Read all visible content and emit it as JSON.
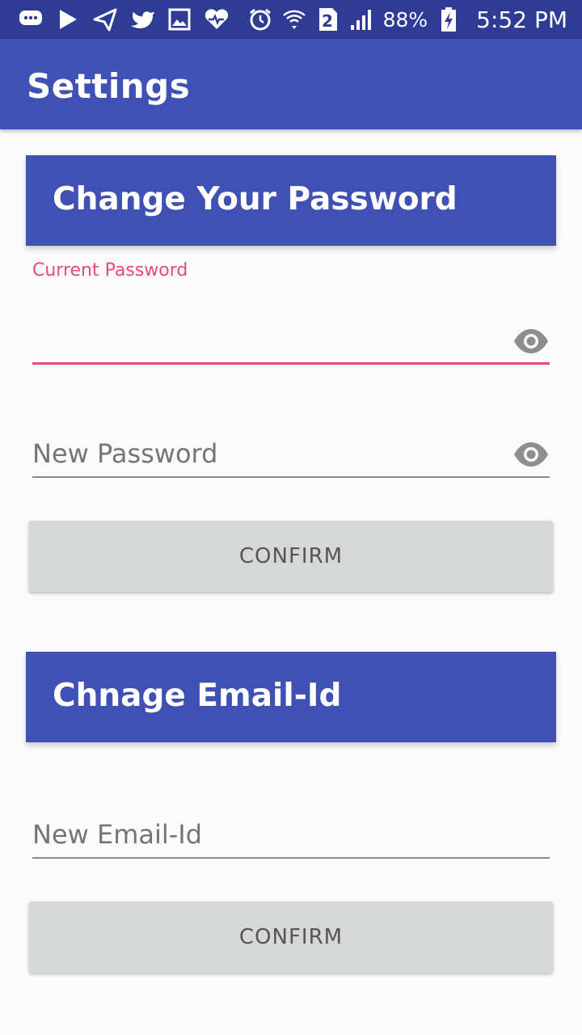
{
  "status_bar": {
    "icons": [
      "chat-bubble-icon",
      "play-store-icon",
      "send-icon",
      "twitter-icon",
      "gallery-icon",
      "heart-icon",
      "alarm-icon",
      "wifi-icon",
      "sim-2-icon",
      "signal-icon",
      "battery-charging-icon"
    ],
    "sim_label": "2",
    "battery": "88%",
    "time": "5:52 PM"
  },
  "app_bar": {
    "title": "Settings"
  },
  "password_section": {
    "title": "Change Your Password",
    "current_password": {
      "label": "Current Password",
      "value": ""
    },
    "new_password": {
      "placeholder": "New Password",
      "value": ""
    },
    "confirm_label": "CONFIRM"
  },
  "email_section": {
    "title": "Chnage Email-Id",
    "new_email": {
      "placeholder": "New Email-Id",
      "value": ""
    },
    "confirm_label": "CONFIRM"
  },
  "colors": {
    "primary": "#3f51b5",
    "status_bar": "#2f3c96",
    "accent": "#e84a7f",
    "button": "#d6d7d7"
  }
}
